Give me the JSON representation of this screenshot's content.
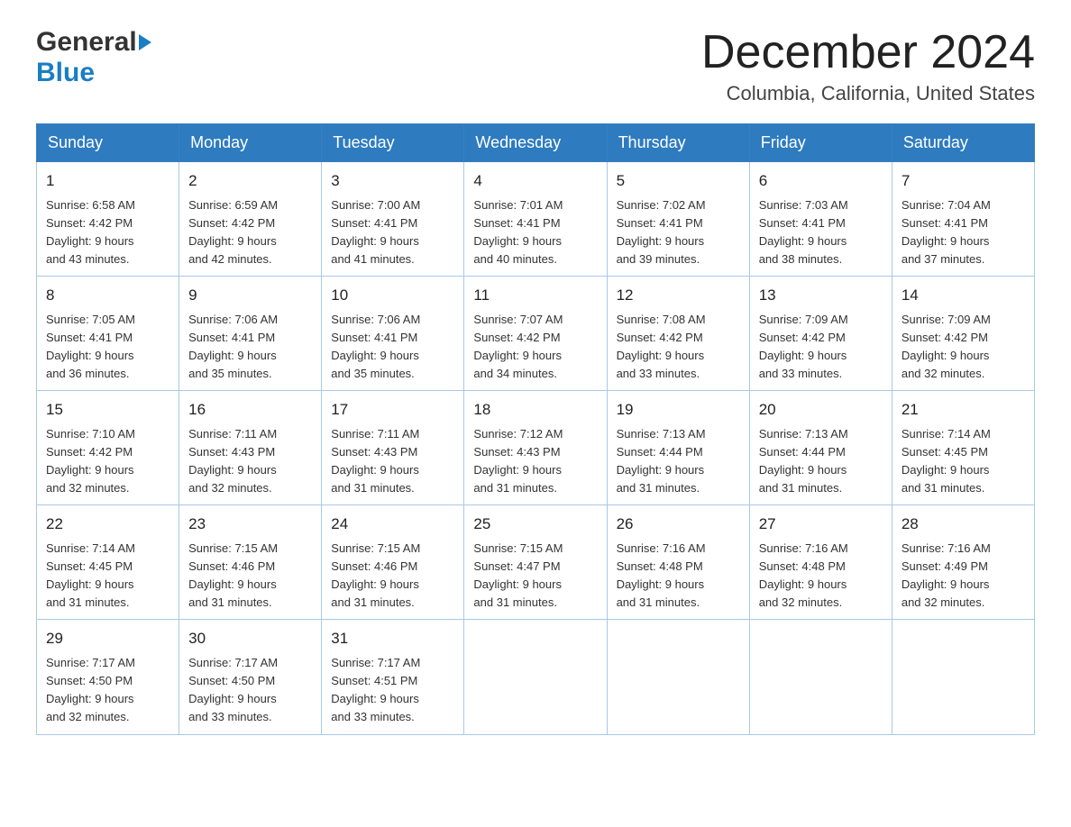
{
  "header": {
    "logo_general": "General",
    "logo_blue": "Blue",
    "title": "December 2024",
    "subtitle": "Columbia, California, United States"
  },
  "days_of_week": [
    "Sunday",
    "Monday",
    "Tuesday",
    "Wednesday",
    "Thursday",
    "Friday",
    "Saturday"
  ],
  "weeks": [
    [
      {
        "day": "1",
        "sunrise": "6:58 AM",
        "sunset": "4:42 PM",
        "daylight": "9 hours and 43 minutes."
      },
      {
        "day": "2",
        "sunrise": "6:59 AM",
        "sunset": "4:42 PM",
        "daylight": "9 hours and 42 minutes."
      },
      {
        "day": "3",
        "sunrise": "7:00 AM",
        "sunset": "4:41 PM",
        "daylight": "9 hours and 41 minutes."
      },
      {
        "day": "4",
        "sunrise": "7:01 AM",
        "sunset": "4:41 PM",
        "daylight": "9 hours and 40 minutes."
      },
      {
        "day": "5",
        "sunrise": "7:02 AM",
        "sunset": "4:41 PM",
        "daylight": "9 hours and 39 minutes."
      },
      {
        "day": "6",
        "sunrise": "7:03 AM",
        "sunset": "4:41 PM",
        "daylight": "9 hours and 38 minutes."
      },
      {
        "day": "7",
        "sunrise": "7:04 AM",
        "sunset": "4:41 PM",
        "daylight": "9 hours and 37 minutes."
      }
    ],
    [
      {
        "day": "8",
        "sunrise": "7:05 AM",
        "sunset": "4:41 PM",
        "daylight": "9 hours and 36 minutes."
      },
      {
        "day": "9",
        "sunrise": "7:06 AM",
        "sunset": "4:41 PM",
        "daylight": "9 hours and 35 minutes."
      },
      {
        "day": "10",
        "sunrise": "7:06 AM",
        "sunset": "4:41 PM",
        "daylight": "9 hours and 35 minutes."
      },
      {
        "day": "11",
        "sunrise": "7:07 AM",
        "sunset": "4:42 PM",
        "daylight": "9 hours and 34 minutes."
      },
      {
        "day": "12",
        "sunrise": "7:08 AM",
        "sunset": "4:42 PM",
        "daylight": "9 hours and 33 minutes."
      },
      {
        "day": "13",
        "sunrise": "7:09 AM",
        "sunset": "4:42 PM",
        "daylight": "9 hours and 33 minutes."
      },
      {
        "day": "14",
        "sunrise": "7:09 AM",
        "sunset": "4:42 PM",
        "daylight": "9 hours and 32 minutes."
      }
    ],
    [
      {
        "day": "15",
        "sunrise": "7:10 AM",
        "sunset": "4:42 PM",
        "daylight": "9 hours and 32 minutes."
      },
      {
        "day": "16",
        "sunrise": "7:11 AM",
        "sunset": "4:43 PM",
        "daylight": "9 hours and 32 minutes."
      },
      {
        "day": "17",
        "sunrise": "7:11 AM",
        "sunset": "4:43 PM",
        "daylight": "9 hours and 31 minutes."
      },
      {
        "day": "18",
        "sunrise": "7:12 AM",
        "sunset": "4:43 PM",
        "daylight": "9 hours and 31 minutes."
      },
      {
        "day": "19",
        "sunrise": "7:13 AM",
        "sunset": "4:44 PM",
        "daylight": "9 hours and 31 minutes."
      },
      {
        "day": "20",
        "sunrise": "7:13 AM",
        "sunset": "4:44 PM",
        "daylight": "9 hours and 31 minutes."
      },
      {
        "day": "21",
        "sunrise": "7:14 AM",
        "sunset": "4:45 PM",
        "daylight": "9 hours and 31 minutes."
      }
    ],
    [
      {
        "day": "22",
        "sunrise": "7:14 AM",
        "sunset": "4:45 PM",
        "daylight": "9 hours and 31 minutes."
      },
      {
        "day": "23",
        "sunrise": "7:15 AM",
        "sunset": "4:46 PM",
        "daylight": "9 hours and 31 minutes."
      },
      {
        "day": "24",
        "sunrise": "7:15 AM",
        "sunset": "4:46 PM",
        "daylight": "9 hours and 31 minutes."
      },
      {
        "day": "25",
        "sunrise": "7:15 AM",
        "sunset": "4:47 PM",
        "daylight": "9 hours and 31 minutes."
      },
      {
        "day": "26",
        "sunrise": "7:16 AM",
        "sunset": "4:48 PM",
        "daylight": "9 hours and 31 minutes."
      },
      {
        "day": "27",
        "sunrise": "7:16 AM",
        "sunset": "4:48 PM",
        "daylight": "9 hours and 32 minutes."
      },
      {
        "day": "28",
        "sunrise": "7:16 AM",
        "sunset": "4:49 PM",
        "daylight": "9 hours and 32 minutes."
      }
    ],
    [
      {
        "day": "29",
        "sunrise": "7:17 AM",
        "sunset": "4:50 PM",
        "daylight": "9 hours and 32 minutes."
      },
      {
        "day": "30",
        "sunrise": "7:17 AM",
        "sunset": "4:50 PM",
        "daylight": "9 hours and 33 minutes."
      },
      {
        "day": "31",
        "sunrise": "7:17 AM",
        "sunset": "4:51 PM",
        "daylight": "9 hours and 33 minutes."
      },
      null,
      null,
      null,
      null
    ]
  ],
  "labels": {
    "sunrise": "Sunrise:",
    "sunset": "Sunset:",
    "daylight": "Daylight:"
  }
}
